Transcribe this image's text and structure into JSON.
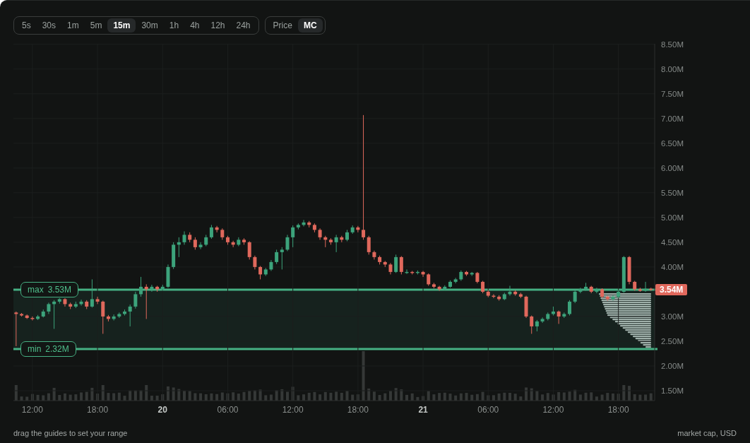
{
  "timeframes": [
    {
      "label": "5s",
      "selected": false
    },
    {
      "label": "30s",
      "selected": false
    },
    {
      "label": "1m",
      "selected": false
    },
    {
      "label": "5m",
      "selected": false
    },
    {
      "label": "15m",
      "selected": true
    },
    {
      "label": "30m",
      "selected": false
    },
    {
      "label": "1h",
      "selected": false
    },
    {
      "label": "4h",
      "selected": false
    },
    {
      "label": "12h",
      "selected": false
    },
    {
      "label": "24h",
      "selected": false
    }
  ],
  "modes": [
    {
      "label": "Price",
      "selected": false
    },
    {
      "label": "MC",
      "selected": true
    }
  ],
  "chart": {
    "current_price": "3.54M",
    "guides": [
      {
        "label": "max",
        "value": "3.53M"
      },
      {
        "label": "min",
        "value": "2.32M"
      }
    ],
    "chart_data": {
      "type": "candlestick",
      "categories": [
        null,
        null,
        null,
        "12:00",
        null,
        null,
        null,
        null,
        null,
        null,
        null,
        null,
        null,
        null,
        null,
        "18:00",
        null,
        null,
        null,
        null,
        null,
        null,
        null,
        null,
        null,
        null,
        null,
        "20",
        null,
        null,
        null,
        null,
        null,
        null,
        null,
        null,
        null,
        null,
        null,
        "06:00",
        null,
        null,
        null,
        null,
        null,
        null,
        null,
        null,
        null,
        null,
        null,
        "12:00",
        null,
        null,
        null,
        null,
        null,
        null,
        null,
        null,
        null,
        null,
        null,
        "18:00",
        null,
        null,
        null,
        null,
        null,
        null,
        null,
        null,
        null,
        null,
        null,
        "21",
        null,
        null,
        null,
        null,
        null,
        null,
        null,
        null,
        null,
        null,
        null,
        "06:00",
        null,
        null,
        null,
        null,
        null,
        null,
        null,
        null,
        null,
        null,
        null,
        "12:00",
        null,
        null,
        null,
        null,
        null,
        null,
        null,
        null,
        null,
        null,
        null,
        "18:00",
        null,
        null,
        null,
        null,
        null,
        null
      ],
      "ylim": [
        1.3,
        8.51
      ],
      "ohlc": [
        [
          3.08,
          3.1,
          2.4,
          3.05
        ],
        [
          3.05,
          3.07,
          3.0,
          3.02
        ],
        [
          3.02,
          3.04,
          2.95,
          2.97
        ],
        [
          2.97,
          3.0,
          2.92,
          2.95
        ],
        [
          2.95,
          3.03,
          2.93,
          3.0
        ],
        [
          3.0,
          3.14,
          2.98,
          3.1
        ],
        [
          3.1,
          3.28,
          3.05,
          3.25
        ],
        [
          3.25,
          3.33,
          2.75,
          3.3
        ],
        [
          3.3,
          3.37,
          3.26,
          3.35
        ],
        [
          3.35,
          3.37,
          3.2,
          3.25
        ],
        [
          3.25,
          3.28,
          3.15,
          3.2
        ],
        [
          3.2,
          3.3,
          3.17,
          3.25
        ],
        [
          3.25,
          3.34,
          3.22,
          3.3
        ],
        [
          3.3,
          3.33,
          3.15,
          3.2
        ],
        [
          3.2,
          3.75,
          3.18,
          3.35
        ],
        [
          3.35,
          3.4,
          3.25,
          3.3
        ],
        [
          3.3,
          3.32,
          2.65,
          3.0
        ],
        [
          3.0,
          3.03,
          2.9,
          2.95
        ],
        [
          2.95,
          3.04,
          2.92,
          3.0
        ],
        [
          3.0,
          3.08,
          2.97,
          3.05
        ],
        [
          3.05,
          3.14,
          3.02,
          3.1
        ],
        [
          3.1,
          3.24,
          2.8,
          3.2
        ],
        [
          3.2,
          3.5,
          3.16,
          3.45
        ],
        [
          3.45,
          3.8,
          3.4,
          3.6
        ],
        [
          3.6,
          3.65,
          2.95,
          3.55
        ],
        [
          3.55,
          3.64,
          3.5,
          3.6
        ],
        [
          3.6,
          3.62,
          3.5,
          3.55
        ],
        [
          3.55,
          3.64,
          3.52,
          3.6
        ],
        [
          3.6,
          4.05,
          3.58,
          4.0
        ],
        [
          4.0,
          4.5,
          3.96,
          4.45
        ],
        [
          4.45,
          4.6,
          4.2,
          4.5
        ],
        [
          4.5,
          4.72,
          4.45,
          4.65
        ],
        [
          4.65,
          4.7,
          4.5,
          4.55
        ],
        [
          4.55,
          4.6,
          4.35,
          4.4
        ],
        [
          4.4,
          4.5,
          4.36,
          4.45
        ],
        [
          4.45,
          4.65,
          4.42,
          4.6
        ],
        [
          4.6,
          4.85,
          4.57,
          4.8
        ],
        [
          4.8,
          4.83,
          4.7,
          4.75
        ],
        [
          4.75,
          4.78,
          4.55,
          4.6
        ],
        [
          4.6,
          4.63,
          4.45,
          4.5
        ],
        [
          4.5,
          4.53,
          4.4,
          4.45
        ],
        [
          4.45,
          4.6,
          4.42,
          4.55
        ],
        [
          4.55,
          4.58,
          4.45,
          4.5
        ],
        [
          4.5,
          4.52,
          4.15,
          4.2
        ],
        [
          4.2,
          4.23,
          3.95,
          4.0
        ],
        [
          4.0,
          4.02,
          3.75,
          3.85
        ],
        [
          3.85,
          3.98,
          3.82,
          3.95
        ],
        [
          3.95,
          4.14,
          3.92,
          4.1
        ],
        [
          4.1,
          4.35,
          4.06,
          4.3
        ],
        [
          4.3,
          4.4,
          3.95,
          4.35
        ],
        [
          4.35,
          4.65,
          4.32,
          4.6
        ],
        [
          4.6,
          4.84,
          4.4,
          4.8
        ],
        [
          4.8,
          4.88,
          4.76,
          4.85
        ],
        [
          4.85,
          4.95,
          4.82,
          4.9
        ],
        [
          4.9,
          4.93,
          4.8,
          4.85
        ],
        [
          4.85,
          4.88,
          4.7,
          4.75
        ],
        [
          4.75,
          4.78,
          4.55,
          4.6
        ],
        [
          4.6,
          4.63,
          4.4,
          4.55
        ],
        [
          4.55,
          4.58,
          4.45,
          4.5
        ],
        [
          4.5,
          4.65,
          4.3,
          4.6
        ],
        [
          4.6,
          4.63,
          4.5,
          4.55
        ],
        [
          4.55,
          4.75,
          4.52,
          4.7
        ],
        [
          4.7,
          4.84,
          4.67,
          4.8
        ],
        [
          4.8,
          4.83,
          4.7,
          4.75
        ],
        [
          4.75,
          7.07,
          4.55,
          4.6
        ],
        [
          4.6,
          4.63,
          4.25,
          4.3
        ],
        [
          4.3,
          4.33,
          4.15,
          4.2
        ],
        [
          4.2,
          4.23,
          4.05,
          4.1
        ],
        [
          4.1,
          4.12,
          4.0,
          4.05
        ],
        [
          4.05,
          4.08,
          3.85,
          3.9
        ],
        [
          3.9,
          4.25,
          3.88,
          4.2
        ],
        [
          4.2,
          4.22,
          3.85,
          3.9
        ],
        [
          3.9,
          3.95,
          3.86,
          3.9
        ],
        [
          3.9,
          3.92,
          3.85,
          3.88
        ],
        [
          3.88,
          3.93,
          3.85,
          3.9
        ],
        [
          3.9,
          3.92,
          3.8,
          3.85
        ],
        [
          3.85,
          3.87,
          3.62,
          3.65
        ],
        [
          3.65,
          3.68,
          3.57,
          3.6
        ],
        [
          3.6,
          3.62,
          3.52,
          3.55
        ],
        [
          3.55,
          3.63,
          3.53,
          3.6
        ],
        [
          3.6,
          3.73,
          3.58,
          3.7
        ],
        [
          3.7,
          3.78,
          3.67,
          3.75
        ],
        [
          3.75,
          3.93,
          3.72,
          3.9
        ],
        [
          3.9,
          3.92,
          3.82,
          3.85
        ],
        [
          3.85,
          3.9,
          3.82,
          3.88
        ],
        [
          3.88,
          3.9,
          3.67,
          3.7
        ],
        [
          3.7,
          3.72,
          3.47,
          3.5
        ],
        [
          3.5,
          3.53,
          3.39,
          3.42
        ],
        [
          3.42,
          3.45,
          3.37,
          3.4
        ],
        [
          3.4,
          3.43,
          3.32,
          3.35
        ],
        [
          3.35,
          3.48,
          3.33,
          3.45
        ],
        [
          3.45,
          3.62,
          3.42,
          3.5
        ],
        [
          3.5,
          3.53,
          3.42,
          3.45
        ],
        [
          3.45,
          3.48,
          3.37,
          3.4
        ],
        [
          3.4,
          3.42,
          2.97,
          3.0
        ],
        [
          3.0,
          3.02,
          2.65,
          2.8
        ],
        [
          2.8,
          2.93,
          2.7,
          2.9
        ],
        [
          2.9,
          2.98,
          2.87,
          2.95
        ],
        [
          2.95,
          3.08,
          2.92,
          3.05
        ],
        [
          3.05,
          3.2,
          3.02,
          3.1
        ],
        [
          3.1,
          3.12,
          2.85,
          3.0
        ],
        [
          3.0,
          3.08,
          2.97,
          3.05
        ],
        [
          3.05,
          3.33,
          3.02,
          3.3
        ],
        [
          3.3,
          3.53,
          3.27,
          3.5
        ],
        [
          3.5,
          3.58,
          3.47,
          3.55
        ],
        [
          3.55,
          3.68,
          3.52,
          3.6
        ],
        [
          3.6,
          3.62,
          3.47,
          3.5
        ],
        [
          3.5,
          3.58,
          3.47,
          3.55
        ],
        [
          3.55,
          3.57,
          3.37,
          3.4
        ],
        [
          3.4,
          3.42,
          3.32,
          3.35
        ],
        [
          3.35,
          3.43,
          3.32,
          3.4
        ],
        [
          3.4,
          3.53,
          3.37,
          3.5
        ],
        [
          3.5,
          4.22,
          3.48,
          4.2
        ],
        [
          4.2,
          4.22,
          3.65,
          3.7
        ],
        [
          3.7,
          3.72,
          3.52,
          3.55
        ],
        [
          3.55,
          3.58,
          3.5,
          3.52
        ],
        [
          3.52,
          3.7,
          3.5,
          3.56
        ],
        [
          3.56,
          3.58,
          3.52,
          3.54
        ]
      ],
      "yticks": [
        {
          "value": 8.5,
          "label": "8.50M"
        },
        {
          "value": 8,
          "label": "8.00M"
        },
        {
          "value": 7.5,
          "label": "7.50M"
        },
        {
          "value": 7,
          "label": "7.00M"
        },
        {
          "value": 6.5,
          "label": "6.50M"
        },
        {
          "value": 6,
          "label": "6.00M"
        },
        {
          "value": 5.5,
          "label": "5.50M"
        },
        {
          "value": 5,
          "label": "5.00M"
        },
        {
          "value": 4.5,
          "label": "4.50M"
        },
        {
          "value": 4,
          "label": "4.00M"
        },
        {
          "value": 3,
          "label": "3.00M"
        },
        {
          "value": 2.5,
          "label": "2.50M"
        },
        {
          "value": 2,
          "label": "2.00M"
        },
        {
          "value": 1.5,
          "label": "1.50M"
        }
      ],
      "grid": true
    },
    "x_labels_bold": [
      false,
      false,
      true,
      false,
      false,
      false,
      true,
      false,
      false,
      false
    ]
  },
  "footer": {
    "hint": "drag the guides to set your range",
    "unit": "market cap, USD"
  }
}
